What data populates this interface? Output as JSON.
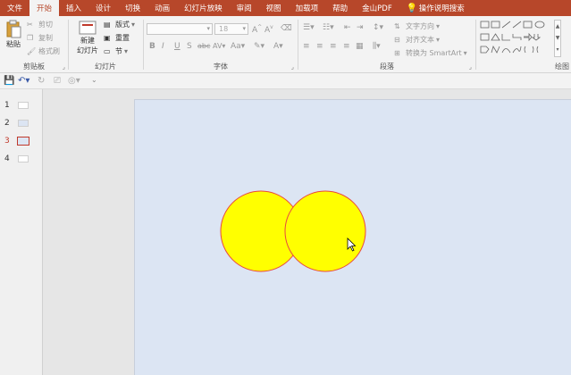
{
  "tabs": [
    "文件",
    "开始",
    "插入",
    "设计",
    "切换",
    "动画",
    "幻灯片放映",
    "审阅",
    "视图",
    "加载项",
    "帮助",
    "金山PDF",
    "操作说明搜索"
  ],
  "active_tab_index": 1,
  "clipboard": {
    "paste": "粘贴",
    "cut": "剪切",
    "copy": "复制",
    "format_painter": "格式刷",
    "label": "剪贴板"
  },
  "slides_group": {
    "new_slide_line1": "新建",
    "new_slide_line2": "幻灯片",
    "layout": "版式",
    "reset": "重置",
    "section": "节",
    "label": "幻灯片"
  },
  "font_group": {
    "font_name": "",
    "font_size": "18",
    "label": "字体"
  },
  "paragraph_group": {
    "text_direction": "文字方向",
    "align_text": "对齐文本",
    "smartart": "转换为 SmartArt",
    "label": "段落"
  },
  "drawing_group": {
    "label": "绘图"
  },
  "thumbnails": [
    "1",
    "2",
    "3",
    "4"
  ],
  "active_slide_index": 2,
  "colors": {
    "accent": "#b7472a",
    "slide_bg": "#dce5f3",
    "circle_fill": "#ffff00",
    "circle_stroke": "#e8493f"
  }
}
